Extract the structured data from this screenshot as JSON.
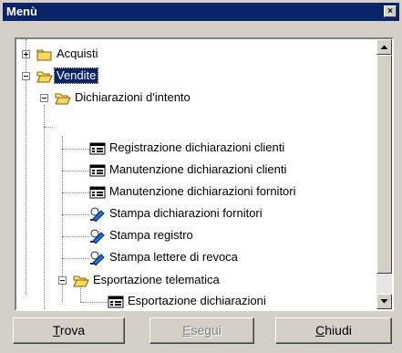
{
  "window": {
    "title": "Menù",
    "close_glyph": "×"
  },
  "tree": {
    "items": [
      {
        "label": "Acquisti",
        "icon": "folder-closed-icon",
        "expander": "plus"
      },
      {
        "label": "Vendite",
        "icon": "folder-open-icon",
        "expander": "minus",
        "selected": true
      },
      {
        "label": "Dichiarazioni d'intento",
        "icon": "folder-open-icon",
        "expander": "minus"
      },
      {
        "label": "Registrazione dichiarazioni clienti",
        "icon": "form-icon"
      },
      {
        "label": "Manutenzione dichiarazioni clienti",
        "icon": "form-icon"
      },
      {
        "label": "Manutenzione dichiarazioni fornitori",
        "icon": "form-icon"
      },
      {
        "label": "Stampa dichiarazioni fornitori",
        "icon": "print-report-icon"
      },
      {
        "label": "Stampa registro",
        "icon": "print-report-icon"
      },
      {
        "label": "Stampa lettere di revoca",
        "icon": "print-report-icon"
      },
      {
        "label": "Esportazione telematica",
        "icon": "folder-open-icon",
        "expander": "minus"
      },
      {
        "label": "Esportazione dichiarazioni",
        "icon": "form-icon"
      }
    ]
  },
  "buttons": {
    "trova": {
      "mnemonic": "T",
      "rest": "rova"
    },
    "esegui": {
      "mnemonic": "E",
      "rest": "segui",
      "disabled": true
    },
    "chiudi": {
      "mnemonic": "C",
      "rest": "hiudi"
    }
  }
}
